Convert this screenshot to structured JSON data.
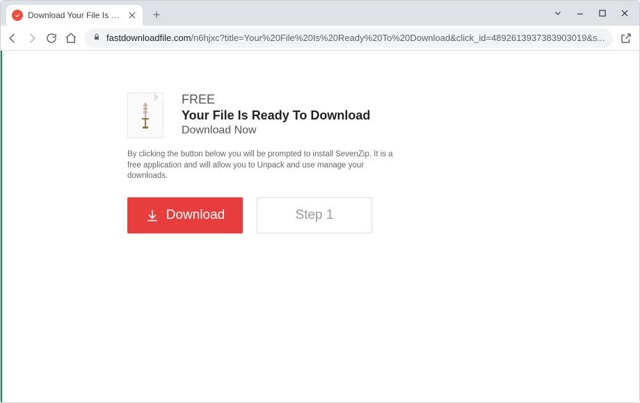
{
  "window": {
    "tab_title": "Download Your File Is Ready To D"
  },
  "address": {
    "domain": "fastdownloadfile.com",
    "path": "/n6hjxc?title=Your%20File%20Is%20Ready%20To%20Download&click_id=4892613937383903019&s..."
  },
  "page": {
    "free": "FREE",
    "title": "Your File Is Ready To Download",
    "subtitle": "Download Now",
    "disclaimer": "By clicking the button below you will be prompted to install SevenZip. It is a free application and will allow you to Unpack and use manage your downloads.",
    "download_label": "Download",
    "step_label": "Step 1"
  }
}
